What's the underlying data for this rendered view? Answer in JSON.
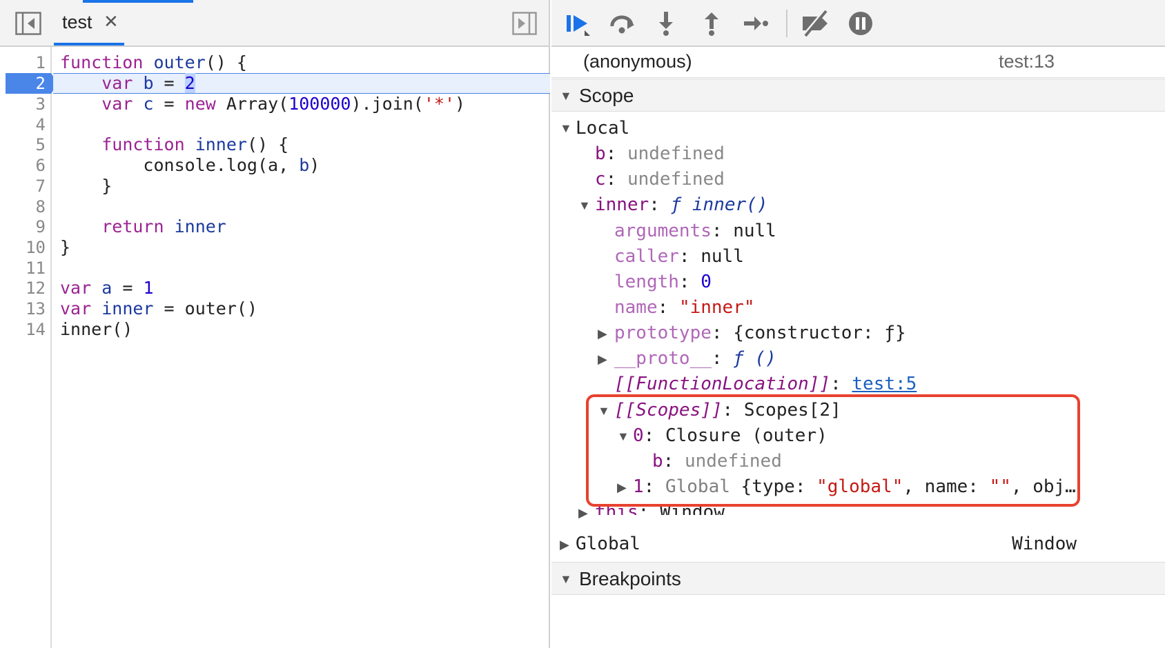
{
  "editor": {
    "tab_label": "test",
    "tab_close": "✕",
    "line_numbers": [
      "1",
      "2",
      "3",
      "4",
      "5",
      "6",
      "7",
      "8",
      "9",
      "10",
      "11",
      "12",
      "13",
      "14"
    ],
    "active_line": "2"
  },
  "code": {
    "l1": {
      "kw": "function",
      "name": "outer",
      "rest": "() {"
    },
    "l2": {
      "indent": "    ",
      "kw": "var",
      "name": "b",
      "eq": " = ",
      "val": "2"
    },
    "l3": {
      "indent": "    ",
      "kw": "var",
      "name": "c",
      "eq": " = ",
      "kw2": "new",
      "a": " Array(",
      "n": "100000",
      "b": ").join(",
      "s": "'*'",
      "c": ")"
    },
    "l5": {
      "indent": "    ",
      "kw": "function",
      "name": "inner",
      "rest": "() {"
    },
    "l6": {
      "indent": "        ",
      "a": "console.log(a, ",
      "v": "b",
      ")": ")"
    },
    "l7": {
      "text": "    }"
    },
    "l9": {
      "indent": "    ",
      "kw": "return",
      "name": "inner"
    },
    "l10": {
      "text": "}"
    },
    "l12": {
      "kw": "var",
      "name": "a",
      "eq": " = ",
      "val": "1"
    },
    "l13": {
      "kw": "var",
      "name": "inner",
      "eq": " = ",
      "rest": "outer()"
    },
    "l14": {
      "text": "inner()"
    }
  },
  "debugger": {
    "frame_name": "(anonymous)",
    "frame_loc": "test:13",
    "scope_label": "Scope",
    "local_label": "Local",
    "b_key": "b",
    "b_val": "undefined",
    "c_key": "c",
    "c_val": "undefined",
    "inner_key": "inner",
    "inner_val": "ƒ inner()",
    "arguments_key": "arguments",
    "arguments_val": "null",
    "caller_key": "caller",
    "caller_val": "null",
    "length_key": "length",
    "length_val": "0",
    "name_key": "name",
    "name_val": "\"inner\"",
    "prototype_key": "prototype",
    "prototype_val": "{constructor: ƒ}",
    "proto_key": "__proto__",
    "proto_val": "ƒ ()",
    "funcloc_key": "[[FunctionLocation]]",
    "funcloc_val": "test:5",
    "scopes_key": "[[Scopes]]",
    "scopes_val": "Scopes[2]",
    "closure_key": "0",
    "closure_val": "Closure (outer)",
    "closure_b_key": "b",
    "closure_b_val": "undefined",
    "global1_key": "1",
    "global1_a": "Global ",
    "global1_b": "{type: ",
    "global1_type": "\"global\"",
    "global1_c": ", name: ",
    "global1_name": "\"\"",
    "global1_d": ", obj…",
    "this_key": "this",
    "this_val": "Window",
    "global_label": "Global",
    "global_val": "Window",
    "breakpoints_label": "Breakpoints"
  },
  "colors": {
    "accent": "#1a73e8",
    "highlight_box": "#e8422f",
    "keyword": "#9b2393",
    "property": "#881280"
  },
  "icons": [
    "sidebar-toggle-icon",
    "close-icon",
    "sidebar-right-icon",
    "resume-icon",
    "step-over-icon",
    "step-into-icon",
    "step-out-icon",
    "step-icon",
    "deactivate-breakpoints-icon",
    "pause-on-exceptions-icon"
  ]
}
